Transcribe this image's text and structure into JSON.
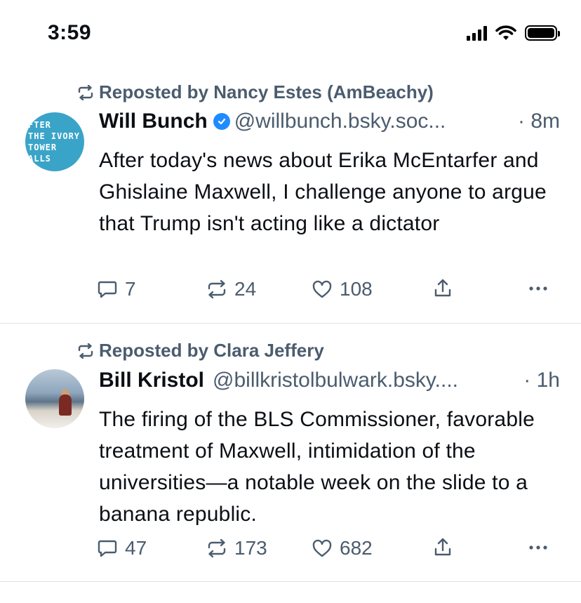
{
  "status_bar": {
    "time": "3:59"
  },
  "posts": [
    {
      "repost_text": "Reposted by Nancy Estes (AmBeachy)",
      "author": "Will Bunch",
      "handle": "@willbunch.bsky.soc...",
      "age": "· 8m",
      "avatar_text": [
        "FTER",
        "THE IVORY",
        "TOWER",
        "ALLS"
      ],
      "text": "After today's news about Erika McEntarfer and Ghislaine Maxwell, I challenge anyone to argue that Trump isn't acting like a dictator",
      "replies": "7",
      "reposts": "24",
      "likes": "108"
    },
    {
      "repost_text": "Reposted by Clara Jeffery",
      "author": "Bill Kristol",
      "handle": "@billkristolbulwark.bsky....",
      "age": "· 1h",
      "text": "The firing of the BLS Commissioner, favorable treatment of Maxwell, intimidation of the universities—a notable week on the slide to a banana republic.",
      "replies": "47",
      "reposts": "173",
      "likes": "682"
    }
  ],
  "colors": {
    "muted": "#4b5c6e",
    "verified": "#208bfe",
    "divider": "#dfe3e8"
  }
}
